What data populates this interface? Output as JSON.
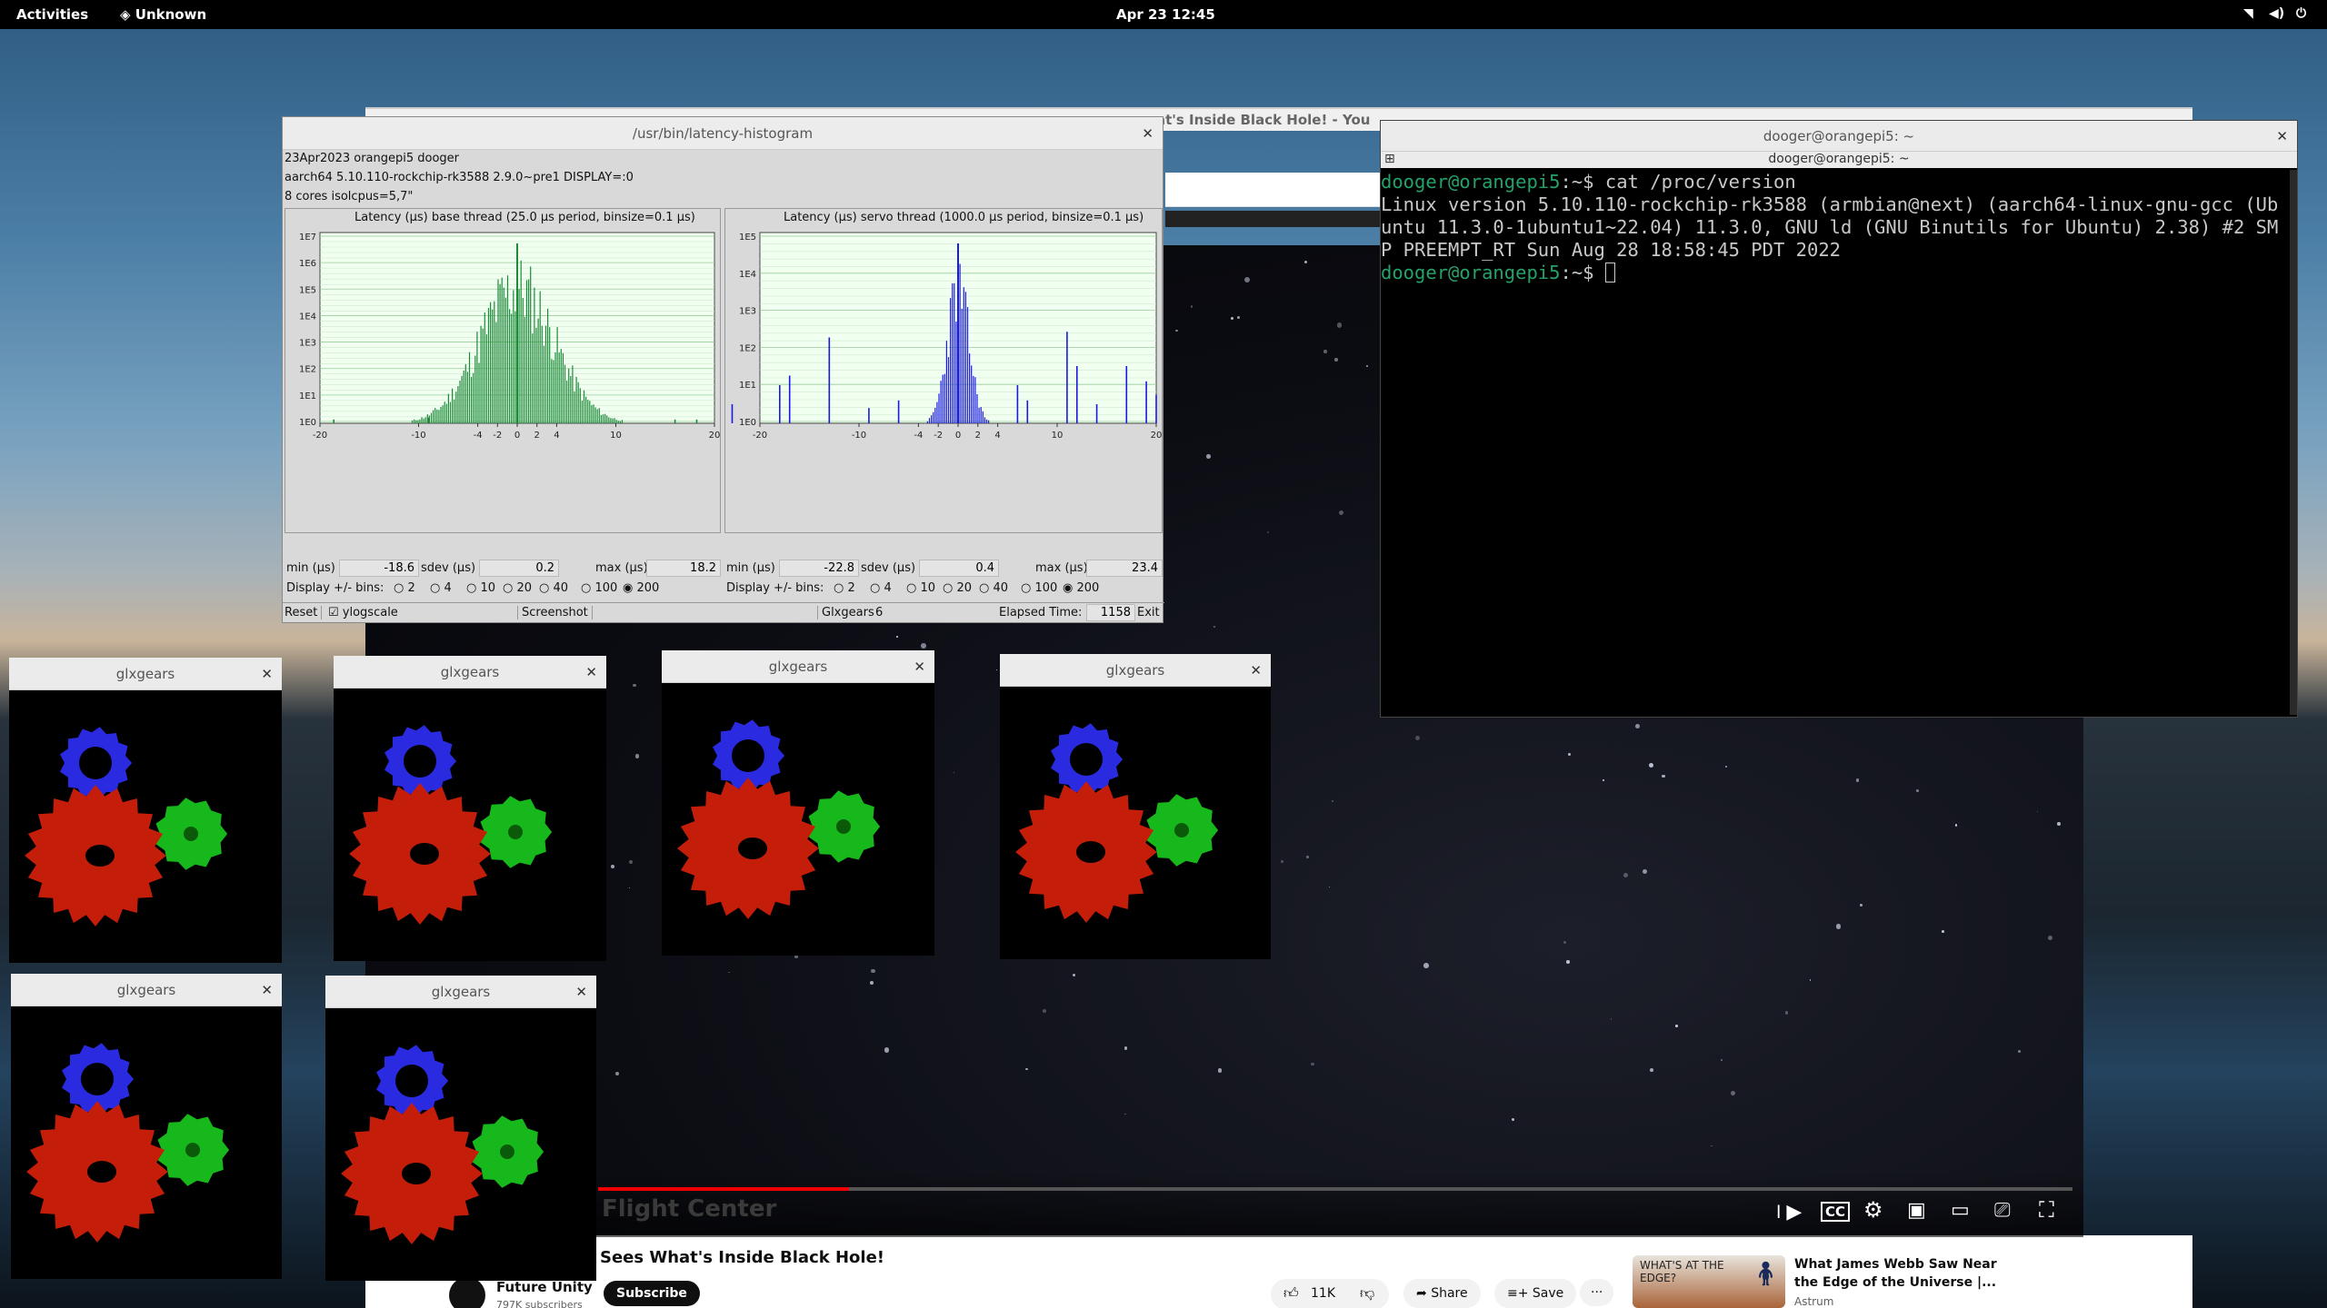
{
  "topbar": {
    "activities": "Activities",
    "app": "Unknown",
    "clock": "Apr 23  12:45"
  },
  "youtube": {
    "window_title": "at's Inside Black Hole! - You",
    "overlay_text": "Flight Center",
    "video_title": "Sees What's Inside Black Hole!",
    "channel": "Future Unity",
    "subscribers": "797K subscribers",
    "subscribe": "Subscribe",
    "likes": "11K",
    "share": "Share",
    "save": "Save",
    "more": "···",
    "progress": 0.17,
    "rec_thumb_text": "WHAT'S AT THE EDGE?",
    "rec_title_1": "What James Webb Saw Near",
    "rec_title_2": "the Edge of the Universe |...",
    "rec_channel": "Astrum"
  },
  "latency": {
    "title": "/usr/bin/latency-histogram",
    "info1": "23Apr2023 orangepi5 dooger",
    "info2": " aarch64  5.10.110-rockchip-rk3588  2.9.0~pre1  DISPLAY=:0",
    "info3": "8 cores  isolcpus=5,7\"",
    "plot1_title": "Latency (µs) base thread (25.0 µs period, binsize=0.1 µs)",
    "plot2_title": "Latency (µs) servo thread (1000.0 µs period, binsize=0.1 µs)",
    "min_label": "min (µs)",
    "sdev_label": "sdev (µs)",
    "max_label": "max (µs)",
    "b_min": "-18.6",
    "b_sdev": "0.2",
    "b_max": "18.2",
    "s_min": "-22.8",
    "s_sdev": "0.4",
    "s_max": "23.4",
    "bins_label": "Display +/- bins:",
    "bins": [
      "2",
      "4",
      "10",
      "20",
      "40",
      "100",
      "200"
    ],
    "reset": "Reset",
    "ylog": "ylogscale",
    "screenshot": "Screenshot",
    "glxgears": "Glxgears",
    "glx_count": "6",
    "elapsed_label": "Elapsed Time:",
    "elapsed": "1158",
    "exit": "Exit",
    "y1_ticks": [
      "1E7",
      "1E6",
      "1E5",
      "1E4",
      "1E3",
      "1E2",
      "1E1",
      "1E0"
    ],
    "y2_ticks": [
      "1E5",
      "1E4",
      "1E3",
      "1E2",
      "1E1",
      "1E0"
    ],
    "x_ticks": [
      "-20",
      "-10",
      "-4",
      "-2",
      "0",
      "2",
      "4",
      "10",
      "20"
    ]
  },
  "terminal": {
    "title": "dooger@orangepi5: ~",
    "tab_title": "dooger@orangepi5: ~",
    "prompt_user": "dooger@orangepi5",
    "prompt_rest": ":~$ ",
    "cmd": "cat /proc/version",
    "out1": "Linux version 5.10.110-rockchip-rk3588 (armbian@next) (aarch64-linux-gnu-gcc (Ub",
    "out2": "untu 11.3.0-1ubuntu1~22.04) 11.3.0, GNU ld (GNU Binutils for Ubuntu) 2.38) #2 SM",
    "out3": "P PREEMPT_RT Sun Aug 28 18:58:45 PDT 2022"
  },
  "gears": {
    "title": "glxgears"
  },
  "colors": {
    "gear_red": "#c41e0a",
    "gear_green": "#17b81c",
    "gear_blue": "#2a2ae0",
    "prompt_green": "#26a269"
  }
}
